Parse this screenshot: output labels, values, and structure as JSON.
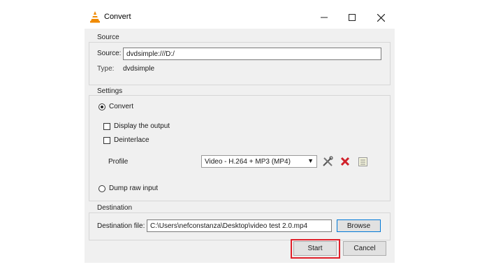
{
  "window": {
    "title": "Convert",
    "minimize_icon": "minimize-icon",
    "maximize_icon": "maximize-icon",
    "close_icon": "close-icon"
  },
  "source": {
    "group_label": "Source",
    "source_label": "Source:",
    "source_value": "dvdsimple:///D:/",
    "type_label": "Type:",
    "type_value": "dvdsimple"
  },
  "settings": {
    "group_label": "Settings",
    "convert_label": "Convert",
    "convert_selected": true,
    "display_output_label": "Display the output",
    "display_output_checked": false,
    "deinterlace_label": "Deinterlace",
    "deinterlace_checked": false,
    "profile_label": "Profile",
    "profile_value": "Video - H.264 + MP3 (MP4)",
    "dump_raw_label": "Dump raw input",
    "dump_raw_selected": false
  },
  "destination": {
    "group_label": "Destination",
    "file_label": "Destination file:",
    "file_value": "C:\\Users\\nefconstanza\\Desktop\\video test 2.0.mp4",
    "browse_label": "Browse"
  },
  "actions": {
    "start_label": "Start",
    "cancel_label": "Cancel"
  },
  "colors": {
    "highlight": "#e0202a",
    "delete_red": "#d0202a",
    "vlc_orange": "#f08a00",
    "focus_blue": "#0078d7"
  }
}
